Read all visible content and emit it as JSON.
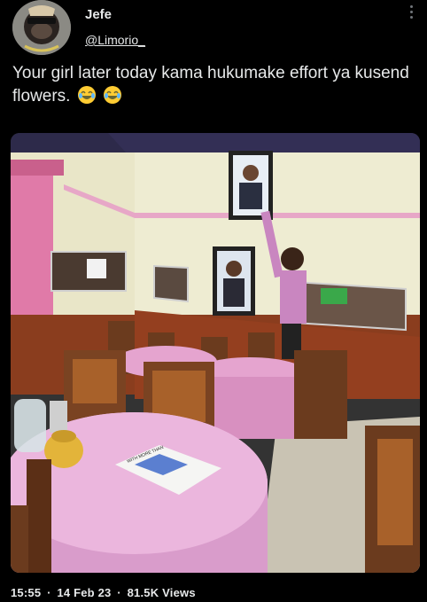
{
  "author": {
    "name": "Jefe",
    "handle": "@Limorio_"
  },
  "tweet": {
    "text": "Your girl later today kama hukumake effort ya kusend flowers.",
    "emojis": [
      "joy-emoji",
      "joy-emoji"
    ]
  },
  "media": {
    "newspaper_headline": "WITH MORE THAN"
  },
  "meta": {
    "time": "15:55",
    "sep1": "·",
    "date": "14 Feb 23",
    "sep2": "·",
    "views_count": "81.5K",
    "views_label": "Views"
  },
  "colors": {
    "background": "#000000",
    "text": "#e7e9ea",
    "secondary": "#71767b"
  }
}
